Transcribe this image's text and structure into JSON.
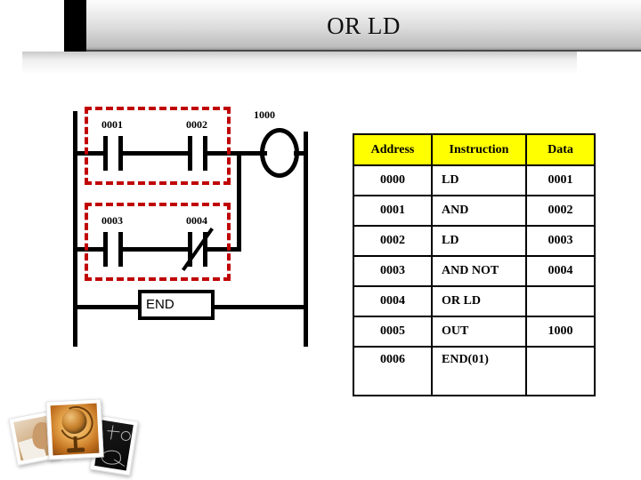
{
  "header": {
    "title": "OR LD"
  },
  "ladder": {
    "rung1": {
      "contacts": [
        {
          "label": "0001",
          "type": "normally-open"
        },
        {
          "label": "0002",
          "type": "normally-open"
        }
      ]
    },
    "rung2": {
      "contacts": [
        {
          "label": "0003",
          "type": "normally-open"
        },
        {
          "label": "0004",
          "type": "normally-closed"
        }
      ]
    },
    "coil": {
      "label": "1000",
      "type": "output-coil"
    },
    "end_block": {
      "label": "END"
    }
  },
  "table": {
    "headers": [
      "Address",
      "Instruction",
      "Data"
    ],
    "rows": [
      {
        "address": "0000",
        "instruction": "LD",
        "data": "0001"
      },
      {
        "address": "0001",
        "instruction": "AND",
        "data": "0002"
      },
      {
        "address": "0002",
        "instruction": "LD",
        "data": "0003"
      },
      {
        "address": "0003",
        "instruction": "AND NOT",
        "data": "0004"
      },
      {
        "address": "0004",
        "instruction": "OR LD",
        "data": ""
      },
      {
        "address": "0005",
        "instruction": "OUT",
        "data": "1000"
      },
      {
        "address": "0006",
        "instruction": "END(01)",
        "data": ""
      }
    ]
  },
  "colors": {
    "highlight_box": "#c00000",
    "table_header_bg": "#ffff00",
    "accent_bar": "#000000"
  }
}
